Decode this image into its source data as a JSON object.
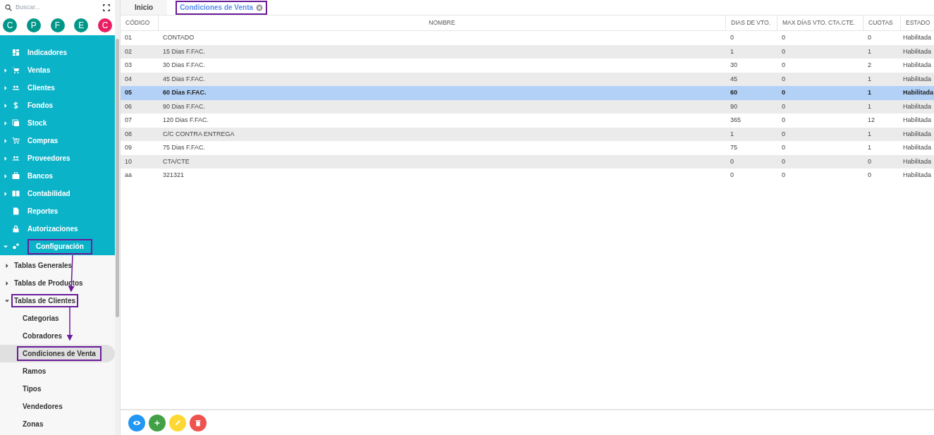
{
  "sidebar": {
    "search": {
      "placeholder": "Buscar..."
    },
    "avatars": [
      {
        "letter": "C",
        "color": "#009688"
      },
      {
        "letter": "P",
        "color": "#009688"
      },
      {
        "letter": "F",
        "color": "#009688"
      },
      {
        "letter": "E",
        "color": "#009688"
      },
      {
        "letter": "C",
        "color": "#e91e63"
      }
    ],
    "menu": [
      {
        "label": "Indicadores"
      },
      {
        "label": "Ventas",
        "expanded": false
      },
      {
        "label": "Clientes",
        "expanded": false
      },
      {
        "label": "Fondos",
        "expanded": false
      },
      {
        "label": "Stock",
        "expanded": false
      },
      {
        "label": "Compras",
        "expanded": false
      },
      {
        "label": "Proveedores",
        "expanded": false
      },
      {
        "label": "Bancos",
        "expanded": false
      },
      {
        "label": "Contabilidad",
        "expanded": false
      },
      {
        "label": "Reportes"
      },
      {
        "label": "Autorizaciones"
      },
      {
        "label": "Configuración",
        "expanded": true,
        "highlighted": true,
        "children": [
          {
            "label": "Tablas Generales",
            "expanded": false,
            "highlighted": false
          },
          {
            "label": "Tablas de Productos",
            "expanded": false,
            "highlighted": false
          },
          {
            "label": "Tablas de Clientes",
            "expanded": true,
            "highlighted": true,
            "children": [
              {
                "label": "Categorias",
                "selected": false,
                "highlighted": false
              },
              {
                "label": "Cobradores",
                "selected": false,
                "highlighted": false
              },
              {
                "label": "Condiciones de Venta",
                "selected": true,
                "highlighted": true
              },
              {
                "label": "Ramos",
                "selected": false,
                "highlighted": false
              },
              {
                "label": "Tipos",
                "selected": false,
                "highlighted": false
              },
              {
                "label": "Vendedores",
                "selected": false,
                "highlighted": false
              },
              {
                "label": "Zonas",
                "selected": false,
                "highlighted": false
              }
            ]
          }
        ]
      }
    ]
  },
  "tabs": [
    {
      "label": "Inicio",
      "selected": false
    },
    {
      "label": "Condiciones de Venta",
      "selected": true,
      "closable": true,
      "highlighted": true
    }
  ],
  "table": {
    "columns": [
      "CÓDIGO",
      "NOMBRE",
      "DIAS DE VTO.",
      "MAX DÍAS VTO. CTA.CTE.",
      "CUOTAS",
      "ESTADO"
    ],
    "rows": [
      {
        "cells": [
          "01",
          "CONTADO",
          "0",
          "0",
          "0",
          "Habilitada"
        ],
        "selected": false
      },
      {
        "cells": [
          "02",
          "15 Dias F.FAC.",
          "1",
          "0",
          "1",
          "Habilitada"
        ],
        "selected": false
      },
      {
        "cells": [
          "03",
          "30 Dias F.FAC.",
          "30",
          "0",
          "2",
          "Habilitada"
        ],
        "selected": false
      },
      {
        "cells": [
          "04",
          "45 Dias F.FAC.",
          "45",
          "0",
          "1",
          "Habilitada"
        ],
        "selected": false
      },
      {
        "cells": [
          "05",
          "60 Dias F.FAC.",
          "60",
          "0",
          "1",
          "Habilitada"
        ],
        "selected": true
      },
      {
        "cells": [
          "06",
          "90 Dias F.FAC.",
          "90",
          "0",
          "1",
          "Habilitada"
        ],
        "selected": false
      },
      {
        "cells": [
          "07",
          "120 Dias F.FAC.",
          "365",
          "0",
          "12",
          "Habilitada"
        ],
        "selected": false
      },
      {
        "cells": [
          "08",
          "C/C CONTRA ENTREGA",
          "1",
          "0",
          "1",
          "Habilitada"
        ],
        "selected": false
      },
      {
        "cells": [
          "09",
          "75 Dias F.FAC.",
          "75",
          "0",
          "1",
          "Habilitada"
        ],
        "selected": false
      },
      {
        "cells": [
          "10",
          "CTA/CTE",
          "0",
          "0",
          "0",
          "Habilitada"
        ],
        "selected": false
      },
      {
        "cells": [
          "aa",
          "321321",
          "0",
          "0",
          "0",
          "Habilitada"
        ],
        "selected": false
      }
    ]
  },
  "actions": [
    {
      "kind": "view"
    },
    {
      "kind": "add"
    },
    {
      "kind": "edit"
    },
    {
      "kind": "delete"
    }
  ]
}
